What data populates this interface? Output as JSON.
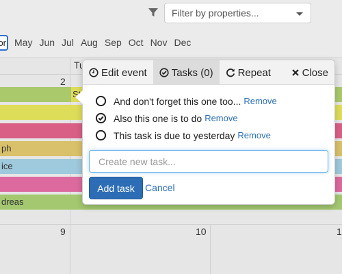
{
  "filter": {
    "placeholder": "Filter by properties..."
  },
  "months": {
    "active": "or",
    "items": [
      "May",
      "Jun",
      "Jul",
      "Aug",
      "Sep",
      "Oct",
      "Nov",
      "Dec"
    ]
  },
  "calendar": {
    "day_header": "Tu",
    "days": {
      "week1_num": "2",
      "week2_a": "9",
      "week2_b": "10",
      "week2_c": "1"
    },
    "events": [
      {
        "label": "",
        "color": "#a9c96b"
      },
      {
        "label": "St",
        "color": "#dedd5a"
      },
      {
        "label": "",
        "color": "#d95f86"
      },
      {
        "label": "ph",
        "color": "#d9c06a"
      },
      {
        "label": "ice",
        "color": "#9fc9dc"
      },
      {
        "label": "",
        "color": "#dc6a9e"
      },
      {
        "label": "dreas",
        "color": "#a3c870"
      }
    ]
  },
  "popover": {
    "tabs": {
      "edit": "Edit event",
      "tasks": "Tasks (0)",
      "repeat": "Repeat",
      "close": "Close"
    },
    "tasks": [
      {
        "label": "And don't forget this one too...",
        "checked": false,
        "remove": "Remove"
      },
      {
        "label": "Also this one is to do",
        "checked": true,
        "remove": "Remove"
      },
      {
        "label": "This task is due to yesterday",
        "checked": false,
        "remove": "Remove"
      }
    ],
    "new_task_placeholder": "Create new task...",
    "add_label": "Add task",
    "cancel_label": "Cancel"
  },
  "colors": {
    "accent": "#2d6db5",
    "link": "#2a6eb4"
  }
}
